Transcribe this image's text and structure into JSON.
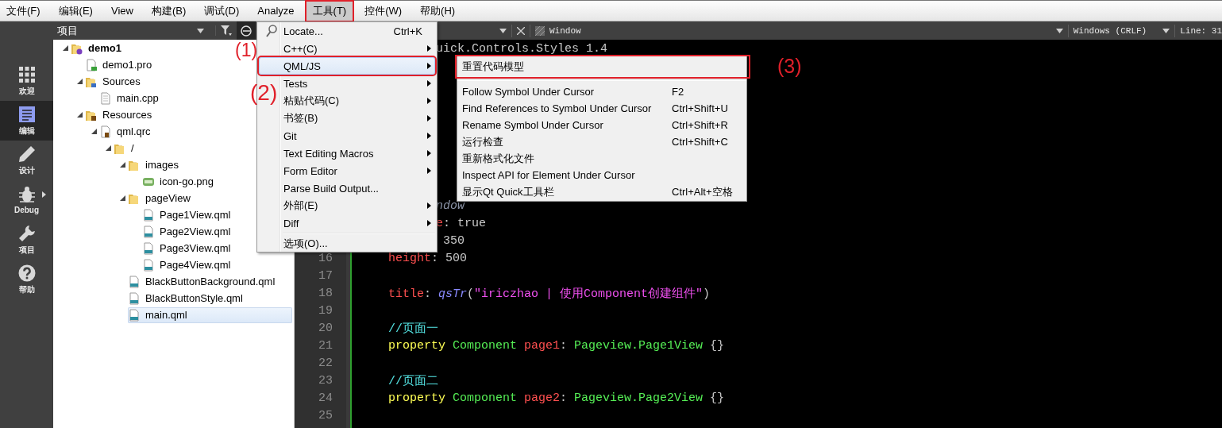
{
  "menubar": {
    "items": [
      {
        "label": "文件(F)",
        "selected": false,
        "annotated": false
      },
      {
        "label": "编辑(E)",
        "selected": false,
        "annotated": false
      },
      {
        "label": "View",
        "selected": false,
        "annotated": false
      },
      {
        "label": "构建(B)",
        "selected": false,
        "annotated": false
      },
      {
        "label": "调试(D)",
        "selected": false,
        "annotated": false
      },
      {
        "label": "Analyze",
        "selected": false,
        "annotated": false
      },
      {
        "label": "工具(T)",
        "selected": true,
        "annotated": true
      },
      {
        "label": "控件(W)",
        "selected": false,
        "annotated": false
      },
      {
        "label": "帮助(H)",
        "selected": false,
        "annotated": false
      }
    ]
  },
  "sidebar": {
    "modes": [
      {
        "label": "欢迎",
        "kind": "welcome",
        "selected": false
      },
      {
        "label": "编辑",
        "kind": "edit",
        "selected": true
      },
      {
        "label": "设计",
        "kind": "design",
        "selected": false
      },
      {
        "label": "Debug",
        "kind": "debug",
        "selected": false
      },
      {
        "label": "项目",
        "kind": "projects",
        "selected": false
      },
      {
        "label": "帮助",
        "kind": "help",
        "selected": false
      }
    ]
  },
  "project_panel": {
    "title": "项目",
    "tree": [
      {
        "label": "demo1",
        "kind": "project",
        "expanded": true,
        "selected": false,
        "children": [
          {
            "label": "demo1.pro",
            "kind": "pro",
            "selected": false
          },
          {
            "label": "Sources",
            "kind": "folder-cpp",
            "expanded": true,
            "selected": false,
            "children": [
              {
                "label": "main.cpp",
                "kind": "file",
                "selected": false
              }
            ]
          },
          {
            "label": "Resources",
            "kind": "folder-res",
            "expanded": true,
            "selected": false,
            "children": [
              {
                "label": "qml.qrc",
                "kind": "qrc",
                "expanded": true,
                "selected": false,
                "children": [
                  {
                    "label": "/",
                    "kind": "folder",
                    "expanded": true,
                    "selected": false,
                    "children": [
                      {
                        "label": "images",
                        "kind": "folder",
                        "expanded": true,
                        "selected": false,
                        "children": [
                          {
                            "label": "icon-go.png",
                            "kind": "png",
                            "selected": false
                          }
                        ]
                      },
                      {
                        "label": "pageView",
                        "kind": "folder",
                        "expanded": true,
                        "selected": false,
                        "children": [
                          {
                            "label": "Page1View.qml",
                            "kind": "qml",
                            "selected": false
                          },
                          {
                            "label": "Page2View.qml",
                            "kind": "qml",
                            "selected": false
                          },
                          {
                            "label": "Page3View.qml",
                            "kind": "qml",
                            "selected": false
                          },
                          {
                            "label": "Page4View.qml",
                            "kind": "qml",
                            "selected": false
                          }
                        ]
                      },
                      {
                        "label": "BlackButtonBackground.qml",
                        "kind": "qml",
                        "selected": false
                      },
                      {
                        "label": "BlackButtonStyle.qml",
                        "kind": "qml",
                        "selected": false
                      },
                      {
                        "label": "main.qml",
                        "kind": "qml",
                        "selected": true
                      }
                    ]
                  }
                ]
              }
            ]
          }
        ]
      }
    ]
  },
  "editor": {
    "toolbar": {
      "symbol": "Window",
      "line_ending": "Windows (CRLF)",
      "position": "Line: 31"
    },
    "top_fragment": [
      {
        "text": "uick.Controls.Styles 1.4",
        "kind": "plain"
      }
    ],
    "lines": [
      {
        "kind": "partial",
        "tokens": [
          {
            "text": "ndow",
            "kind": "type-italic"
          }
        ]
      },
      {
        "kind": "partial",
        "tokens": [
          {
            "text": "e",
            "kind": "property"
          },
          {
            "text": ": true",
            "kind": "plain"
          }
        ]
      },
      {
        "kind": "partial",
        "tokens": [
          {
            "text": " 350",
            "kind": "plain"
          }
        ]
      },
      {
        "kind": "code",
        "number": "16",
        "tokens": [
          {
            "text": "height",
            "kind": "property"
          },
          {
            "text": ": 500",
            "kind": "plain"
          }
        ]
      },
      {
        "kind": "code",
        "number": "17"
      },
      {
        "kind": "code",
        "number": "18",
        "tokens": [
          {
            "text": "title",
            "kind": "property"
          },
          {
            "text": ": ",
            "kind": "plain"
          },
          {
            "text": "qsTr",
            "kind": "function"
          },
          {
            "text": "(",
            "kind": "plain"
          },
          {
            "text": "\"iriczhao | 使用Component创建组件\"",
            "kind": "string"
          },
          {
            "text": ")",
            "kind": "plain"
          }
        ]
      },
      {
        "kind": "code",
        "number": "19"
      },
      {
        "kind": "code",
        "number": "20",
        "tokens": [
          {
            "text": "//页面一",
            "kind": "comment"
          }
        ]
      },
      {
        "kind": "code",
        "number": "21",
        "tokens": [
          {
            "text": "property ",
            "kind": "keyword"
          },
          {
            "text": "Component ",
            "kind": "type"
          },
          {
            "text": "page1",
            "kind": "property"
          },
          {
            "text": ": ",
            "kind": "plain"
          },
          {
            "text": "Pageview.Page1View",
            "kind": "type"
          },
          {
            "text": " {}",
            "kind": "plain"
          }
        ]
      },
      {
        "kind": "code",
        "number": "22"
      },
      {
        "kind": "code",
        "number": "23",
        "tokens": [
          {
            "text": "//页面二",
            "kind": "comment"
          }
        ]
      },
      {
        "kind": "code",
        "number": "24",
        "tokens": [
          {
            "text": "property ",
            "kind": "keyword"
          },
          {
            "text": "Component ",
            "kind": "type"
          },
          {
            "text": "page2",
            "kind": "property"
          },
          {
            "text": ": ",
            "kind": "plain"
          },
          {
            "text": "Pageview.Page2View",
            "kind": "type"
          },
          {
            "text": " {}",
            "kind": "plain"
          }
        ]
      },
      {
        "kind": "code",
        "number": "25"
      }
    ]
  },
  "tools_menu": {
    "items": [
      {
        "kind": "search",
        "label": "Locate...",
        "shortcut": "Ctrl+K",
        "submenu": false,
        "selected": false,
        "annotated": false
      },
      {
        "kind": "command",
        "label": "C++(C)",
        "submenu": true,
        "selected": false,
        "annotated": false
      },
      {
        "kind": "command",
        "label": "QML/JS",
        "submenu": true,
        "selected": true,
        "annotated": true
      },
      {
        "kind": "command",
        "label": "Tests",
        "submenu": true,
        "selected": false,
        "annotated": false
      },
      {
        "kind": "command",
        "label": "粘贴代码(C)",
        "submenu": true,
        "selected": false,
        "annotated": false
      },
      {
        "kind": "command",
        "label": "书签(B)",
        "submenu": true,
        "selected": false,
        "annotated": false
      },
      {
        "kind": "command",
        "label": "Git",
        "submenu": true,
        "selected": false,
        "annotated": false
      },
      {
        "kind": "command",
        "label": "Text Editing Macros",
        "submenu": true,
        "selected": false,
        "annotated": false
      },
      {
        "kind": "command",
        "label": "Form Editor",
        "submenu": true,
        "selected": false,
        "annotated": false
      },
      {
        "kind": "command",
        "label": "Parse Build Output...",
        "submenu": false,
        "selected": false,
        "annotated": false
      },
      {
        "kind": "command",
        "label": "外部(E)",
        "submenu": true,
        "selected": false,
        "annotated": false
      },
      {
        "kind": "command",
        "label": "Diff",
        "submenu": true,
        "selected": false,
        "annotated": false
      },
      {
        "kind": "separator"
      },
      {
        "kind": "command",
        "label": "选项(O)...",
        "submenu": false,
        "selected": false,
        "annotated": false
      }
    ]
  },
  "qml_submenu": {
    "items": [
      {
        "kind": "command",
        "label": "重置代码模型",
        "selected": false,
        "annotated": true
      },
      {
        "kind": "separator"
      },
      {
        "kind": "command",
        "label": "Follow Symbol Under Cursor",
        "shortcut": "F2",
        "selected": false,
        "annotated": false
      },
      {
        "kind": "command",
        "label": "Find References to Symbol Under Cursor",
        "shortcut": "Ctrl+Shift+U",
        "selected": false,
        "annotated": false
      },
      {
        "kind": "command",
        "label": "Rename Symbol Under Cursor",
        "shortcut": "Ctrl+Shift+R",
        "selected": false,
        "annotated": false
      },
      {
        "kind": "command",
        "label": "运行检查",
        "shortcut": "Ctrl+Shift+C",
        "selected": false,
        "annotated": false
      },
      {
        "kind": "command",
        "label": "重新格式化文件",
        "selected": false,
        "annotated": false
      },
      {
        "kind": "command",
        "label": "Inspect API for Element Under Cursor",
        "selected": false,
        "annotated": false
      },
      {
        "kind": "command",
        "label": "显示Qt Quick工具栏",
        "shortcut": "Ctrl+Alt+空格",
        "selected": false,
        "annotated": false
      }
    ]
  },
  "annotations": [
    {
      "label": "(1)"
    },
    {
      "label": "(2)"
    },
    {
      "label": "(3)"
    }
  ]
}
